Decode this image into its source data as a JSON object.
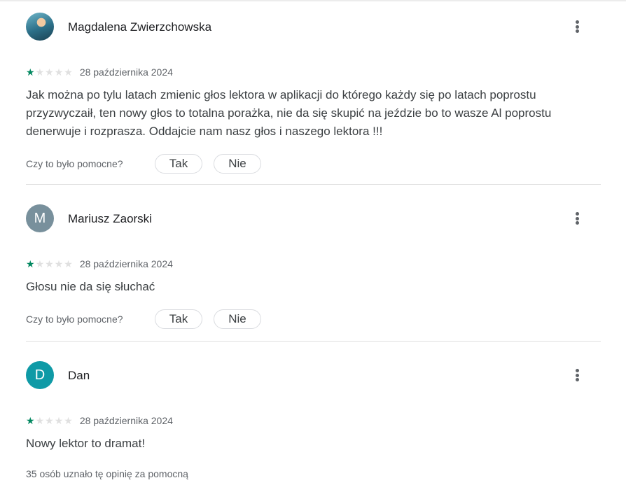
{
  "reviews": [
    {
      "author": "Magdalena Zwierzchowska",
      "avatar": "photo",
      "rating": 1,
      "date": "28 października 2024",
      "text": "Jak można po tylu latach zmienic głos lektora w aplikacji do którego każdy się po latach poprostu przyzwyczaił, ten nowy głos to totalna porażka, nie da się skupić na jeździe bo to wasze Al poprostu denerwuje i rozprasza. Oddajcie nam nasz głos i naszego lektora !!!",
      "helpful_question": "Czy to było pomocne?",
      "yes_label": "Tak",
      "no_label": "Nie"
    },
    {
      "author": "Mariusz Zaorski",
      "avatar_letter": "M",
      "rating": 1,
      "date": "28 października 2024",
      "text": "Głosu nie da się słuchać",
      "helpful_question": "Czy to było pomocne?",
      "yes_label": "Tak",
      "no_label": "Nie"
    },
    {
      "author": "Dan",
      "avatar_letter": "D",
      "rating": 1,
      "date": "28 października 2024",
      "text": "Nowy lektor to dramat!",
      "helpful_count_text": "35 osób uznało tę opinię za pomocną"
    }
  ],
  "colors": {
    "star_filled": "#01875f",
    "star_empty": "#e0e0e0",
    "avatar_m": "#78909c",
    "avatar_d": "#0f9aa6"
  },
  "icons": {
    "menu": "more-vert-icon",
    "star": "star-icon"
  }
}
